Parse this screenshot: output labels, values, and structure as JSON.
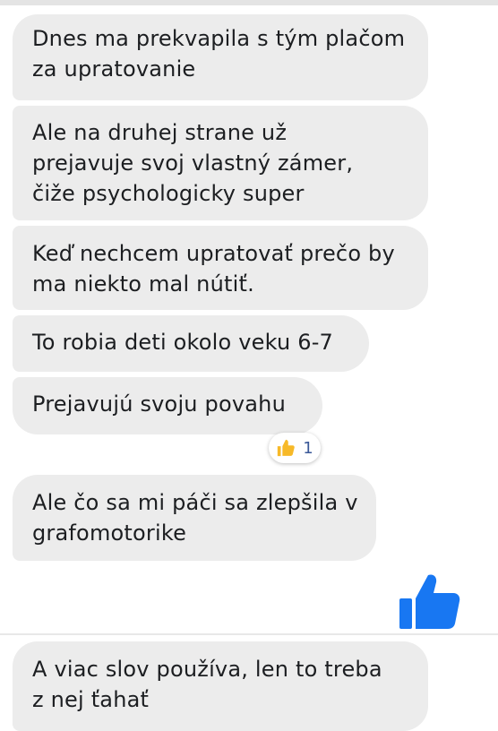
{
  "messages": [
    {
      "lines": [
        "Dnes ma prekvapila s tým plačom",
        "za upratovanie"
      ]
    },
    {
      "lines": [
        "Ale na druhej strane už",
        "prejavuje svoj vlastný zámer,",
        "čiže psychologicky super"
      ]
    },
    {
      "lines": [
        "Keď nechcem upratovať prečo by",
        "ma niekto mal nútiť."
      ]
    },
    {
      "lines": [
        "To robia deti okolo veku 6-7"
      ]
    },
    {
      "lines": [
        "Prejavujú svoju povahu"
      ]
    },
    {
      "lines": [
        "Ale čo sa mi páči sa zlepšila v",
        "grafomotorike"
      ]
    },
    {
      "lines": [
        "A viac slov používa, len to treba",
        "z nej ťahať"
      ]
    }
  ],
  "reaction": {
    "icon": "thumbs-up-icon",
    "count": "1",
    "color": "#f7b928"
  },
  "sent_like": {
    "icon": "thumbs-up-icon",
    "color": "#1877f2"
  },
  "colors": {
    "bubble": "#ececec",
    "text": "#1c1e21"
  }
}
